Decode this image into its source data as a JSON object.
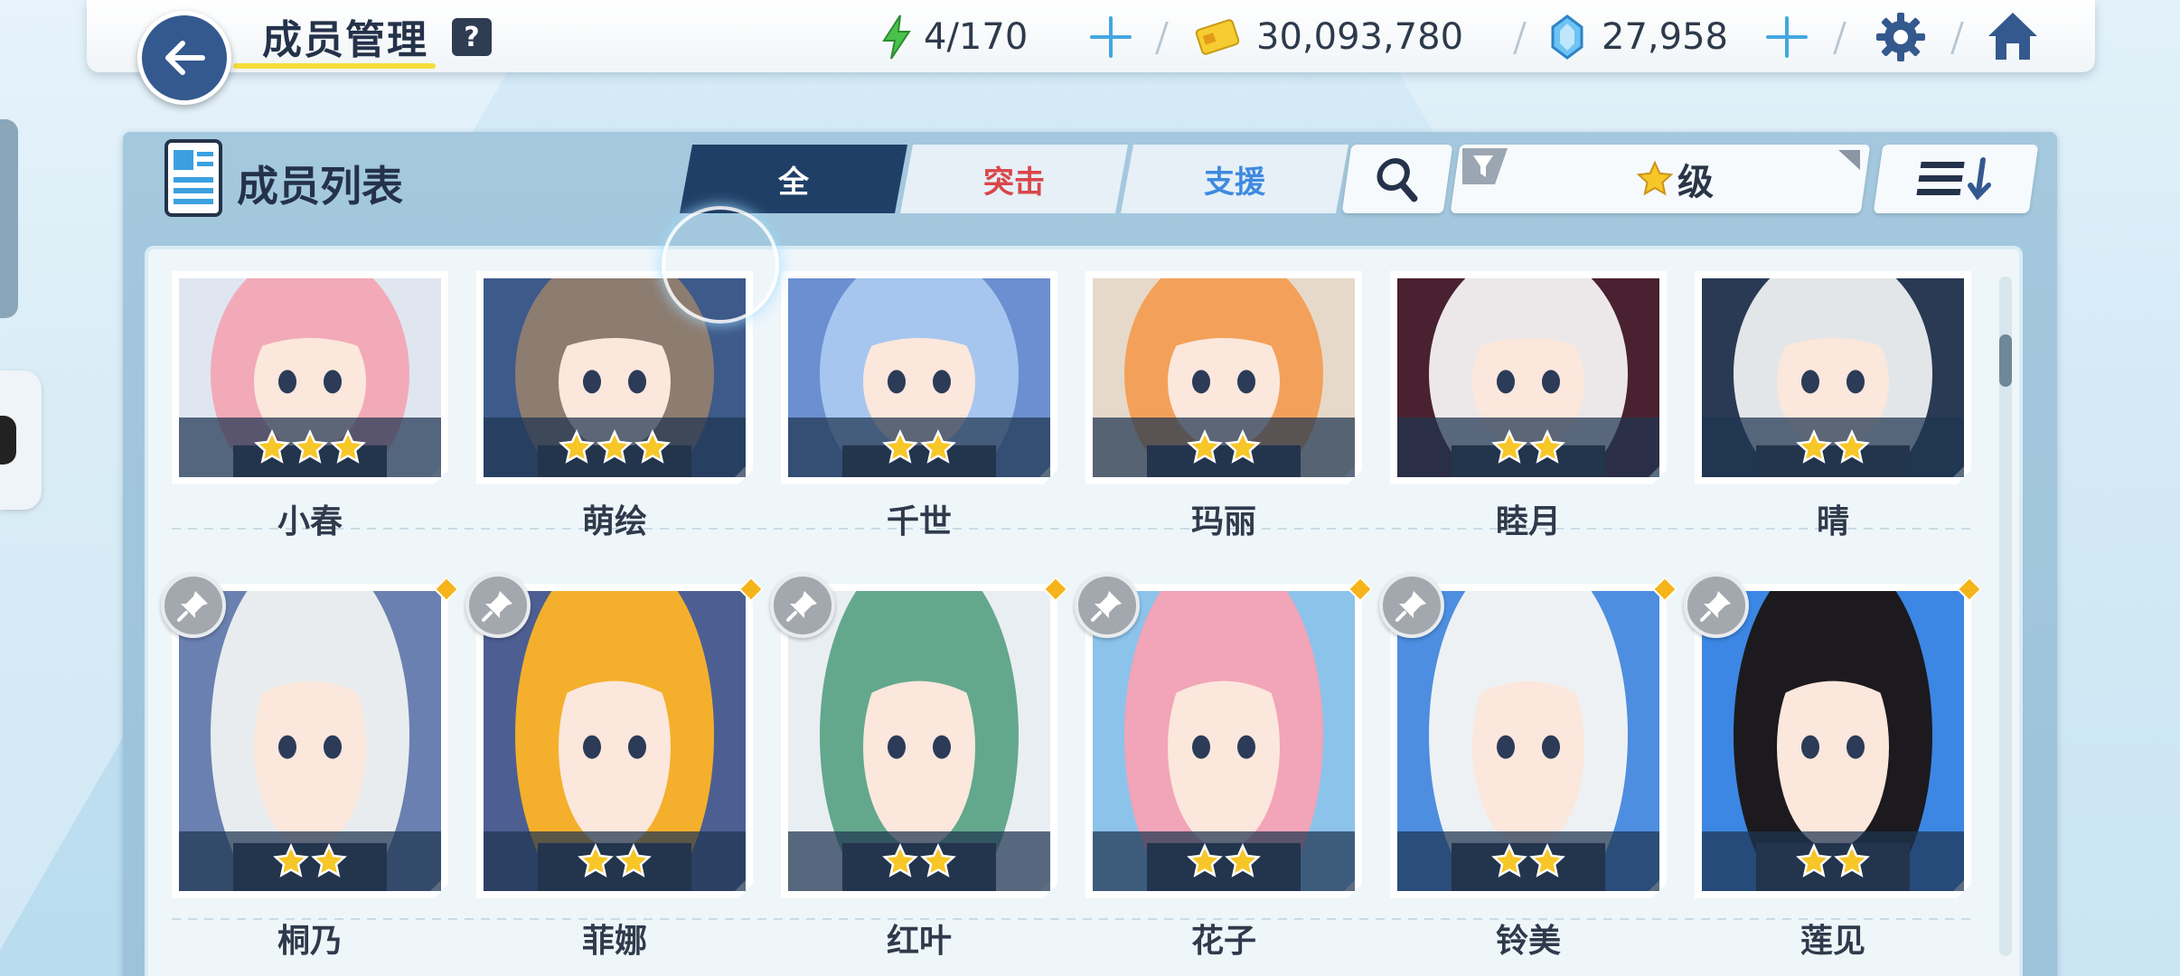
{
  "header": {
    "title": "成员管理",
    "help_label": "?",
    "ap": "4/170",
    "credits": "30,093,780",
    "gems": "27,958"
  },
  "panel": {
    "title": "成员列表",
    "tabs": [
      {
        "label": "全",
        "color": "#ffffff"
      },
      {
        "label": "突击",
        "color": "#d9464a"
      },
      {
        "label": "支援",
        "color": "#3e8ae0"
      }
    ],
    "filter_label": "级",
    "sort_icon": "sort-descending-icon"
  },
  "colors": {
    "accent_dark": "#1f3f66",
    "back_button": "#34598e",
    "star": "#f7c627",
    "new_marker": "#f4b41a"
  },
  "students": [
    {
      "name": "小春",
      "stars": 3,
      "pinnable": false,
      "hair": "#f2aab9",
      "bg": "#dfe6f0"
    },
    {
      "name": "萌绘",
      "stars": 3,
      "pinnable": false,
      "hair": "#8d7c70",
      "bg": "#3d5a8a"
    },
    {
      "name": "千世",
      "stars": 2,
      "pinnable": false,
      "hair": "#a7c6ef",
      "bg": "#6b8fd0"
    },
    {
      "name": "玛丽",
      "stars": 2,
      "pinnable": false,
      "hair": "#f3a15a",
      "bg": "#e7d9c9"
    },
    {
      "name": "睦月",
      "stars": 2,
      "pinnable": false,
      "hair": "#ece8ea",
      "bg": "#4a2130"
    },
    {
      "name": "晴",
      "stars": 2,
      "pinnable": false,
      "hair": "#e3e6e8",
      "bg": "#2a3a55"
    },
    {
      "name": "桐乃",
      "stars": 2,
      "pinnable": true,
      "hair": "#e8ecef",
      "bg": "#6a80b0"
    },
    {
      "name": "菲娜",
      "stars": 2,
      "pinnable": true,
      "hair": "#f4b02c",
      "bg": "#4d5f92"
    },
    {
      "name": "红叶",
      "stars": 2,
      "pinnable": true,
      "hair": "#63a88c",
      "bg": "#e9eef3"
    },
    {
      "name": "花子",
      "stars": 2,
      "pinnable": true,
      "hair": "#f2a4b8",
      "bg": "#8cc3ea"
    },
    {
      "name": "铃美",
      "stars": 2,
      "pinnable": true,
      "hair": "#eef1f4",
      "bg": "#4d8ee0"
    },
    {
      "name": "莲见",
      "stars": 2,
      "pinnable": true,
      "hair": "#1c1a1e",
      "bg": "#3c87e4"
    }
  ]
}
